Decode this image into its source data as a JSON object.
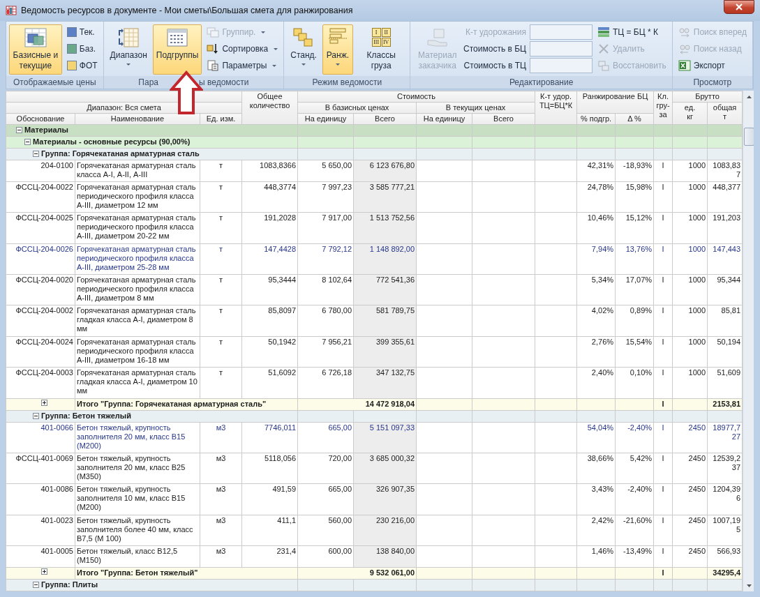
{
  "window": {
    "title": "Ведомость ресурсов в документе - Мои сметы\\Большая смета для ранжирования"
  },
  "ribbon": {
    "groups": [
      {
        "label": "Отображаемые цены",
        "items": [
          {
            "kind": "large",
            "label": "Базисные и текущие",
            "selected": true,
            "disabled": false,
            "dropdown": false
          },
          {
            "kind": "small",
            "label": "Тек.",
            "color": "#5b80c6",
            "disabled": false,
            "dropdown": false
          },
          {
            "kind": "small",
            "label": "Баз.",
            "color": "#6aa88a",
            "disabled": false,
            "dropdown": false
          },
          {
            "kind": "small",
            "label": "ФОТ",
            "color": "#f4d470",
            "disabled": false,
            "dropdown": false
          }
        ]
      },
      {
        "label_parts": [
          "Пара",
          "ы ведомости"
        ],
        "items": [
          {
            "kind": "large",
            "label": "Диапазон",
            "selected": false,
            "disabled": false,
            "dropdown": true
          },
          {
            "kind": "large",
            "label": "Подгруппы",
            "selected": true,
            "disabled": false,
            "dropdown": false
          },
          {
            "kind": "small",
            "label": "Группир.",
            "disabled": true,
            "dropdown": true
          },
          {
            "kind": "small",
            "label": "Сортировка",
            "disabled": false,
            "dropdown": true
          },
          {
            "kind": "small",
            "label": "Параметры",
            "disabled": false,
            "dropdown": true
          }
        ]
      },
      {
        "label": "Режим ведомости",
        "items": [
          {
            "kind": "large",
            "label": "Станд.",
            "selected": false,
            "disabled": false,
            "dropdown": true
          },
          {
            "kind": "large",
            "label": "Ранж.",
            "selected": true,
            "disabled": false,
            "dropdown": true
          },
          {
            "kind": "large",
            "label": "Классы груза",
            "icon_labels": [
              "I",
              "II",
              "III",
              "IV"
            ],
            "selected": false,
            "disabled": false,
            "dropdown": false
          }
        ]
      },
      {
        "label": "Редактирование",
        "items": [
          {
            "kind": "large",
            "label": "Материал заказчика",
            "selected": false,
            "disabled": true,
            "dropdown": false
          },
          {
            "kind": "field",
            "label": "К-т удорожания",
            "disabled": true
          },
          {
            "kind": "field",
            "label": "Стоимость в БЦ",
            "disabled": false
          },
          {
            "kind": "field",
            "label": "Стоимость в ТЦ",
            "disabled": false
          },
          {
            "kind": "small",
            "label": "ТЦ = БЦ * К",
            "disabled": false,
            "dropdown": false
          },
          {
            "kind": "small",
            "label": "Удалить",
            "disabled": true,
            "dropdown": false
          },
          {
            "kind": "small",
            "label": "Восстановить",
            "disabled": true,
            "dropdown": false
          }
        ]
      },
      {
        "label": "Просмотр",
        "items": [
          {
            "kind": "small",
            "label": "Поиск вперед",
            "disabled": true,
            "dropdown": false
          },
          {
            "kind": "small",
            "label": "Поиск назад",
            "disabled": true,
            "dropdown": false
          },
          {
            "kind": "small",
            "label": "Экспорт",
            "disabled": false,
            "dropdown": false
          }
        ]
      }
    ]
  },
  "annotation": {
    "kind": "arrow"
  },
  "table": {
    "header": {
      "range": "Диапазон: Вся смета",
      "quantity": "Общее количество",
      "cost": "Стоимость",
      "base_prices": "В базисных ценах",
      "current_prices": "В текущих ценах",
      "coef": "К-т удор. ТЦ=БЦ*К",
      "ranking": "Ранжирование БЦ",
      "cargo_class": "Кл. гру-за",
      "gross": "Брутто",
      "gross_unit": "ед. кг",
      "gross_total": "общая т"
    },
    "columns": [
      "Обоснование",
      "Наименование",
      "Ед. изм.",
      "На единицу",
      "Всего",
      "На единицу",
      "Всего",
      "% подгр.",
      "Δ %"
    ],
    "rows": [
      {
        "kind": "category",
        "label": "Материалы",
        "expanded": true,
        "children": [
          {
            "kind": "subcategory",
            "label": "Материалы - основные ресурсы (90,00%)",
            "expanded": true,
            "children": [
              {
                "kind": "group",
                "label": "Группа: Горячекатаная арматурная сталь",
                "expanded": true,
                "children": [
                  {
                    "kind": "item",
                    "highlighted": false,
                    "code": "204-0100",
                    "name": "Горячекатаная арматурная сталь класса А-I, А-II, А-III",
                    "unit": "т",
                    "qty": "1083,8366",
                    "bc_unit": "5 650,00",
                    "bc_total": "6 123 676,80",
                    "pct": "42,31%",
                    "delta": "-18,93%",
                    "cls": "I",
                    "kg": "1000",
                    "total_t": "1083,837"
                  },
                  {
                    "kind": "item",
                    "highlighted": false,
                    "code": "ФССЦ-204-0022",
                    "name": "Горячекатаная арматурная сталь периодического профиля класса А-III, диаметром 12 мм",
                    "unit": "т",
                    "qty": "448,3774",
                    "bc_unit": "7 997,23",
                    "bc_total": "3 585 777,21",
                    "pct": "24,78%",
                    "delta": "15,98%",
                    "cls": "I",
                    "kg": "1000",
                    "total_t": "448,377"
                  },
                  {
                    "kind": "item",
                    "highlighted": false,
                    "code": "ФССЦ-204-0025",
                    "name": "Горячекатаная арматурная сталь периодического профиля класса А-III, диаметром 20-22 мм",
                    "unit": "т",
                    "qty": "191,2028",
                    "bc_unit": "7 917,00",
                    "bc_total": "1 513 752,56",
                    "pct": "10,46%",
                    "delta": "15,12%",
                    "cls": "I",
                    "kg": "1000",
                    "total_t": "191,203"
                  },
                  {
                    "kind": "item",
                    "highlighted": true,
                    "code": "ФССЦ-204-0026",
                    "name": "Горячекатаная арматурная сталь периодического профиля класса А-III, диаметром 25-28 мм",
                    "unit": "т",
                    "qty": "147,4428",
                    "bc_unit": "7 792,12",
                    "bc_total": "1 148 892,00",
                    "pct": "7,94%",
                    "delta": "13,76%",
                    "cls": "I",
                    "kg": "1000",
                    "total_t": "147,443"
                  },
                  {
                    "kind": "item",
                    "highlighted": false,
                    "code": "ФССЦ-204-0020",
                    "name": "Горячекатаная арматурная сталь периодического профиля класса А-III, диаметром 8 мм",
                    "unit": "т",
                    "qty": "95,3444",
                    "bc_unit": "8 102,64",
                    "bc_total": "772 541,36",
                    "pct": "5,34%",
                    "delta": "17,07%",
                    "cls": "I",
                    "kg": "1000",
                    "total_t": "95,344"
                  },
                  {
                    "kind": "item",
                    "highlighted": false,
                    "code": "ФССЦ-204-0002",
                    "name": "Горячекатаная арматурная сталь гладкая класса А-I, диаметром 8 мм",
                    "unit": "т",
                    "qty": "85,8097",
                    "bc_unit": "6 780,00",
                    "bc_total": "581 789,75",
                    "pct": "4,02%",
                    "delta": "0,89%",
                    "cls": "I",
                    "kg": "1000",
                    "total_t": "85,81"
                  },
                  {
                    "kind": "item",
                    "highlighted": false,
                    "code": "ФССЦ-204-0024",
                    "name": "Горячекатаная арматурная сталь периодического профиля класса А-III, диаметром 16-18 мм",
                    "unit": "т",
                    "qty": "50,1942",
                    "bc_unit": "7 956,21",
                    "bc_total": "399 355,61",
                    "pct": "2,76%",
                    "delta": "15,54%",
                    "cls": "I",
                    "kg": "1000",
                    "total_t": "50,194"
                  },
                  {
                    "kind": "item",
                    "highlighted": false,
                    "code": "ФССЦ-204-0003",
                    "name": "Горячекатаная арматурная сталь гладкая класса А-I, диаметром 10 мм",
                    "unit": "т",
                    "qty": "51,6092",
                    "bc_unit": "6 726,18",
                    "bc_total": "347 132,75",
                    "pct": "2,40%",
                    "delta": "0,10%",
                    "cls": "I",
                    "kg": "1000",
                    "total_t": "51,609"
                  },
                  {
                    "kind": "total",
                    "expanded": false,
                    "label": "Итого \"Группа: Горячекатаная арматурная сталь\"",
                    "bc_total": "14 472 918,04",
                    "cls": "I",
                    "total_t": "2153,81"
                  }
                ]
              },
              {
                "kind": "group",
                "label": "Группа: Бетон тяжелый",
                "expanded": true,
                "children": [
                  {
                    "kind": "item",
                    "highlighted": true,
                    "code": "401-0066",
                    "name": "Бетон тяжелый, крупность заполнителя 20 мм, класс В15 (М200)",
                    "unit": "м3",
                    "qty": "7746,011",
                    "bc_unit": "665,00",
                    "bc_total": "5 151 097,33",
                    "pct": "54,04%",
                    "delta": "-2,40%",
                    "cls": "I",
                    "kg": "2450",
                    "total_t": "18977,727"
                  },
                  {
                    "kind": "item",
                    "highlighted": false,
                    "code": "ФССЦ-401-0069",
                    "name": "Бетон тяжелый, крупность заполнителя 20 мм, класс В25 (М350)",
                    "unit": "м3",
                    "qty": "5118,056",
                    "bc_unit": "720,00",
                    "bc_total": "3 685 000,32",
                    "pct": "38,66%",
                    "delta": "5,42%",
                    "cls": "I",
                    "kg": "2450",
                    "total_t": "12539,237"
                  },
                  {
                    "kind": "item",
                    "highlighted": false,
                    "code": "401-0086",
                    "name": "Бетон тяжелый, крупность заполнителя 10 мм, класс В15 (М200)",
                    "unit": "м3",
                    "qty": "491,59",
                    "bc_unit": "665,00",
                    "bc_total": "326 907,35",
                    "pct": "3,43%",
                    "delta": "-2,40%",
                    "cls": "I",
                    "kg": "2450",
                    "total_t": "1204,396"
                  },
                  {
                    "kind": "item",
                    "highlighted": false,
                    "code": "401-0023",
                    "name": "Бетон тяжелый, крупность заполнителя более 40 мм, класс В7,5 (М 100)",
                    "unit": "м3",
                    "qty": "411,1",
                    "bc_unit": "560,00",
                    "bc_total": "230 216,00",
                    "pct": "2,42%",
                    "delta": "-21,60%",
                    "cls": "I",
                    "kg": "2450",
                    "total_t": "1007,195"
                  },
                  {
                    "kind": "item",
                    "highlighted": false,
                    "code": "401-0005",
                    "name": "Бетон тяжелый, класс В12,5 (М150)",
                    "unit": "м3",
                    "qty": "231,4",
                    "bc_unit": "600,00",
                    "bc_total": "138 840,00",
                    "pct": "1,46%",
                    "delta": "-13,49%",
                    "cls": "I",
                    "kg": "2450",
                    "total_t": "566,93"
                  },
                  {
                    "kind": "total",
                    "expanded": false,
                    "label": "Итого \"Группа: Бетон тяжелый\"",
                    "bc_total": "9 532 061,00",
                    "cls": "I",
                    "total_t": "34295,4"
                  }
                ]
              },
              {
                "kind": "group",
                "label": "Группа: Плиты",
                "expanded": true
              }
            ]
          }
        ]
      }
    ]
  }
}
